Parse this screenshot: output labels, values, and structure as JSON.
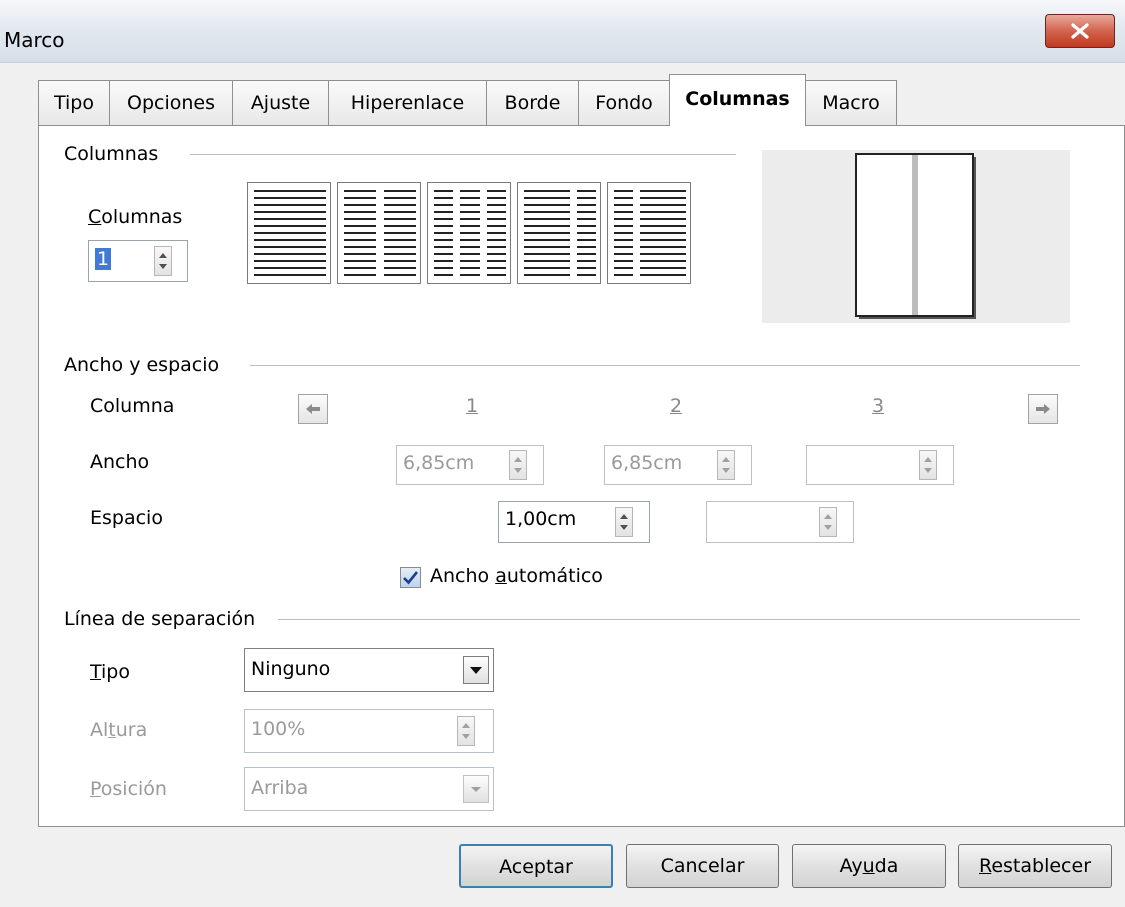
{
  "window": {
    "title": "Marco",
    "close_icon": "close-icon"
  },
  "tabs": [
    {
      "label": "Tipo"
    },
    {
      "label": "Opciones"
    },
    {
      "label": "Ajuste"
    },
    {
      "label": "Hiperenlace"
    },
    {
      "label": "Borde"
    },
    {
      "label": "Fondo"
    },
    {
      "label": "Columnas",
      "active": true
    },
    {
      "label": "Macro"
    }
  ],
  "columnas": {
    "group_label": "Columnas",
    "count_label": "Columnas",
    "count_value": "1",
    "layouts": [
      "one-column",
      "two-columns",
      "three-columns",
      "wide-left",
      "wide-right"
    ]
  },
  "ancho_espacio": {
    "group_label": "Ancho y espacio",
    "columna_label": "Columna",
    "column_numbers": [
      "1",
      "2",
      "3"
    ],
    "ancho_label": "Ancho",
    "ancho_values": [
      "6,85cm",
      "6,85cm",
      ""
    ],
    "espacio_label": "Espacio",
    "espacio_values": [
      "1,00cm",
      ""
    ],
    "auto_width_label": "Ancho automático",
    "auto_width_checked": true
  },
  "separator": {
    "group_label": "Línea de separación",
    "tipo_label": "Tipo",
    "tipo_value": "Ninguno",
    "altura_label": "Altura",
    "altura_value": "100%",
    "posicion_label": "Posición",
    "posicion_value": "Arriba"
  },
  "buttons": {
    "ok": "Aceptar",
    "cancel": "Cancelar",
    "help": "Ayuda",
    "reset": "Restablecer"
  },
  "colors": {
    "title_gradient": "#dfe6ee",
    "close_red": "#c94a33",
    "default_border": "#3c7fb1"
  }
}
